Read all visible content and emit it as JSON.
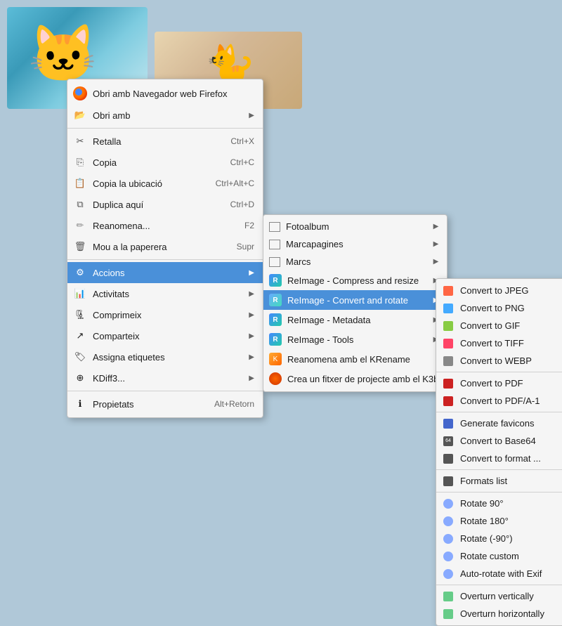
{
  "desktop": {
    "bg_color": "#b0c8d8"
  },
  "main_menu": {
    "title": "main-context-menu",
    "items": [
      {
        "id": "open-firefox",
        "label": "Obri amb Navegador web Firefox",
        "icon": "firefox-icon",
        "shortcut": "",
        "has_arrow": false
      },
      {
        "id": "open-with",
        "label": "Obri amb",
        "icon": "open-icon",
        "shortcut": "",
        "has_arrow": true
      },
      {
        "id": "separator1",
        "type": "separator"
      },
      {
        "id": "cut",
        "label": "Retalla",
        "icon": "scissors-icon",
        "shortcut": "Ctrl+X",
        "has_arrow": false
      },
      {
        "id": "copy",
        "label": "Copia",
        "icon": "copy-icon",
        "shortcut": "Ctrl+C",
        "has_arrow": false
      },
      {
        "id": "copy-location",
        "label": "Copia la ubicació",
        "icon": "location-icon",
        "shortcut": "Ctrl+Alt+C",
        "has_arrow": false
      },
      {
        "id": "duplicate",
        "label": "Duplica aquí",
        "icon": "duplicate-icon",
        "shortcut": "Ctrl+D",
        "has_arrow": false
      },
      {
        "id": "rename",
        "label": "Reanomena...",
        "icon": "rename-icon",
        "shortcut": "F2",
        "has_arrow": false
      },
      {
        "id": "trash",
        "label": "Mou a la paperera",
        "icon": "trash-icon",
        "shortcut": "Supr",
        "has_arrow": false
      },
      {
        "id": "separator2",
        "type": "separator"
      },
      {
        "id": "accions",
        "label": "Accions",
        "icon": "actions-icon",
        "shortcut": "",
        "has_arrow": true,
        "highlighted": true
      },
      {
        "id": "activitats",
        "label": "Activitats",
        "icon": "activities-icon",
        "shortcut": "",
        "has_arrow": true
      },
      {
        "id": "comprimeix",
        "label": "Comprimeix",
        "icon": "compress-icon",
        "shortcut": "",
        "has_arrow": true
      },
      {
        "id": "comparteix",
        "label": "Comparteix",
        "icon": "share-icon",
        "shortcut": "",
        "has_arrow": true
      },
      {
        "id": "assigna",
        "label": "Assigna etiquetes",
        "icon": "tag-icon",
        "shortcut": "",
        "has_arrow": true
      },
      {
        "id": "kdiff",
        "label": "KDiff3...",
        "icon": "kdiff-icon",
        "shortcut": "",
        "has_arrow": true
      },
      {
        "id": "separator3",
        "type": "separator"
      },
      {
        "id": "propietats",
        "label": "Propietats",
        "icon": "properties-icon",
        "shortcut": "Alt+Retorn",
        "has_arrow": false
      }
    ]
  },
  "submenu1": {
    "title": "actions-submenu",
    "items": [
      {
        "id": "fotoalbum",
        "label": "Fotoalbum",
        "icon": "photo-album-icon",
        "has_arrow": true
      },
      {
        "id": "marcapagines",
        "label": "Marcapagines",
        "icon": "bookmark-icon",
        "has_arrow": true
      },
      {
        "id": "marcs",
        "label": "Marcs",
        "icon": "marks-icon",
        "has_arrow": true
      },
      {
        "id": "reimage-compress",
        "label": "ReImage - Compress and resize",
        "icon": "reimage-icon",
        "has_arrow": true
      },
      {
        "id": "reimage-convert",
        "label": "ReImage - Convert and rotate",
        "icon": "reimage-icon",
        "has_arrow": true,
        "highlighted": true
      },
      {
        "id": "reimage-metadata",
        "label": "ReImage - Metadata",
        "icon": "reimage-icon",
        "has_arrow": true
      },
      {
        "id": "reimage-tools",
        "label": "ReImage - Tools",
        "icon": "reimage-icon",
        "has_arrow": true
      },
      {
        "id": "reanomena-krename",
        "label": "Reanomena amb el KRename",
        "icon": "rename-icon",
        "has_arrow": false
      },
      {
        "id": "crea-fitxer",
        "label": "Crea un fitxer de projecte amb el K3b",
        "icon": "k3b-icon",
        "has_arrow": false
      }
    ]
  },
  "submenu2": {
    "title": "convert-rotate-submenu",
    "items": [
      {
        "id": "convert-jpeg",
        "label": "Convert to JPEG",
        "icon": "jpeg-icon"
      },
      {
        "id": "convert-png",
        "label": "Convert to PNG",
        "icon": "png-icon"
      },
      {
        "id": "convert-gif",
        "label": "Convert to GIF",
        "icon": "gif-icon"
      },
      {
        "id": "convert-tiff",
        "label": "Convert to TIFF",
        "icon": "tiff-icon"
      },
      {
        "id": "convert-webp",
        "label": "Convert to WEBP",
        "icon": "webp-icon"
      },
      {
        "id": "separator-conv1",
        "type": "separator"
      },
      {
        "id": "convert-pdf",
        "label": "Convert to PDF",
        "icon": "pdf-icon"
      },
      {
        "id": "convert-pdfa",
        "label": "Convert to PDF/A-1",
        "icon": "pdfa-icon"
      },
      {
        "id": "separator-conv2",
        "type": "separator"
      },
      {
        "id": "generate-favicons",
        "label": "Generate favicons",
        "icon": "favicon-icon"
      },
      {
        "id": "convert-base64",
        "label": "Convert to Base64",
        "icon": "base64-icon"
      },
      {
        "id": "convert-format",
        "label": "Convert to format ...",
        "icon": "format-icon"
      },
      {
        "id": "separator-conv3",
        "type": "separator"
      },
      {
        "id": "formats-list",
        "label": "Formats list",
        "icon": "list-icon"
      },
      {
        "id": "separator-conv4",
        "type": "separator"
      },
      {
        "id": "rotate-90",
        "label": "Rotate 90°",
        "icon": "rotate-icon"
      },
      {
        "id": "rotate-180",
        "label": "Rotate 180°",
        "icon": "rotate-icon"
      },
      {
        "id": "rotate-minus90",
        "label": "Rotate (-90°)",
        "icon": "rotate-icon"
      },
      {
        "id": "rotate-custom",
        "label": "Rotate custom",
        "icon": "rotate-icon"
      },
      {
        "id": "auto-rotate-exif",
        "label": "Auto-rotate with Exif",
        "icon": "rotate-icon"
      },
      {
        "id": "separator-conv5",
        "type": "separator"
      },
      {
        "id": "overturn-vertically",
        "label": "Overturn vertically",
        "icon": "flip-icon"
      },
      {
        "id": "overturn-horizontally",
        "label": "Overturn horizontally",
        "icon": "flip-icon"
      }
    ]
  }
}
